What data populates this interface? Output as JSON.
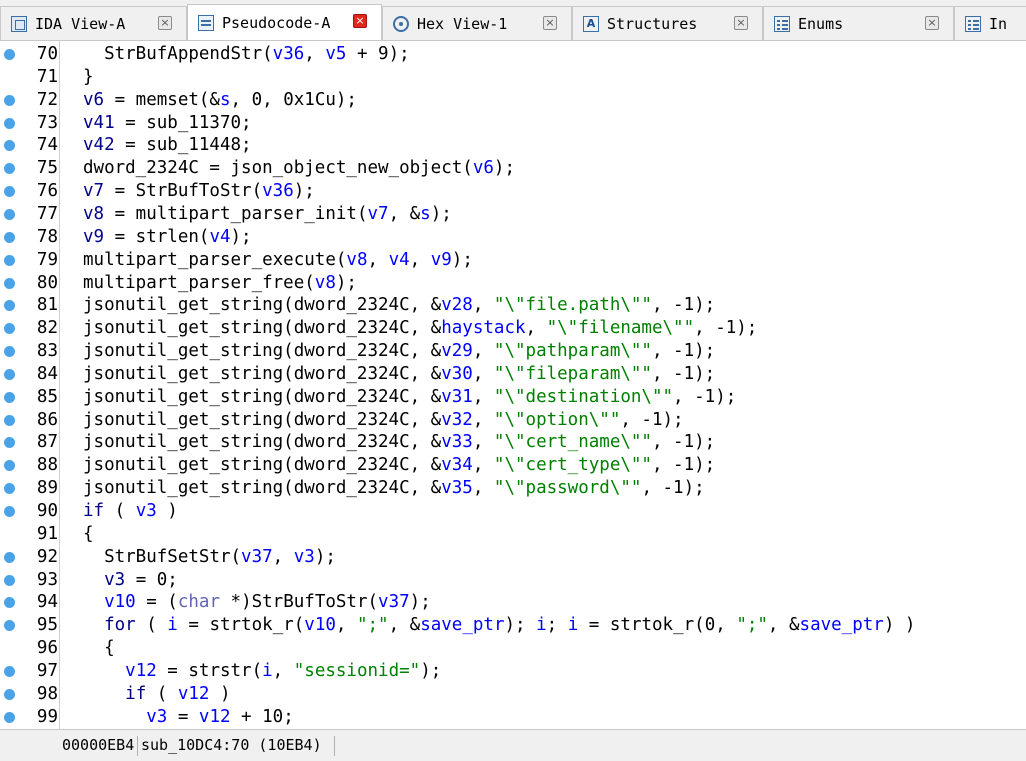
{
  "tabs": [
    {
      "label": "IDA View-A",
      "icon": "ida-view-icon",
      "active": false
    },
    {
      "label": "Pseudocode-A",
      "icon": "pseudocode-icon",
      "active": true
    },
    {
      "label": "Hex View-1",
      "icon": "hex-view-icon",
      "active": false
    },
    {
      "label": "Structures",
      "icon": "structures-icon",
      "active": false
    },
    {
      "label": "Enums",
      "icon": "enums-icon",
      "active": false
    },
    {
      "label": "In",
      "icon": "imports-icon",
      "active": false
    }
  ],
  "code": {
    "lines": [
      {
        "num": "70",
        "bp": true,
        "tokens": [
          [
            "  ",
            ""
          ],
          [
            "StrBufAppendStr",
            ""
          ],
          [
            "(",
            ""
          ],
          [
            "v36",
            "v"
          ],
          [
            ", ",
            ""
          ],
          [
            "v5",
            "v"
          ],
          [
            " + 9);",
            ""
          ]
        ]
      },
      {
        "num": "71",
        "bp": false,
        "tokens": [
          [
            "}",
            ""
          ]
        ]
      },
      {
        "num": "72",
        "bp": true,
        "tokens": [
          [
            "v6",
            "vv"
          ],
          [
            " = memset(&",
            ""
          ],
          [
            "s",
            "v"
          ],
          [
            ", 0, 0x1Cu);",
            ""
          ]
        ]
      },
      {
        "num": "73",
        "bp": true,
        "tokens": [
          [
            "v41",
            "vv"
          ],
          [
            " = sub_11370;",
            ""
          ]
        ]
      },
      {
        "num": "74",
        "bp": true,
        "tokens": [
          [
            "v42",
            "vv"
          ],
          [
            " = sub_11448;",
            ""
          ]
        ]
      },
      {
        "num": "75",
        "bp": true,
        "tokens": [
          [
            "dword_2324C = json_object_new_object(",
            ""
          ],
          [
            "v6",
            "v"
          ],
          [
            ");",
            ""
          ]
        ]
      },
      {
        "num": "76",
        "bp": true,
        "tokens": [
          [
            "v7",
            "vv"
          ],
          [
            " = StrBufToStr(",
            ""
          ],
          [
            "v36",
            "v"
          ],
          [
            ");",
            ""
          ]
        ]
      },
      {
        "num": "77",
        "bp": true,
        "tokens": [
          [
            "v8",
            "vv"
          ],
          [
            " = multipart_parser_init(",
            ""
          ],
          [
            "v7",
            "v"
          ],
          [
            ", &",
            ""
          ],
          [
            "s",
            "v"
          ],
          [
            ");",
            ""
          ]
        ]
      },
      {
        "num": "78",
        "bp": true,
        "tokens": [
          [
            "v9",
            "vv"
          ],
          [
            " = strlen(",
            ""
          ],
          [
            "v4",
            "v"
          ],
          [
            ");",
            ""
          ]
        ]
      },
      {
        "num": "79",
        "bp": true,
        "tokens": [
          [
            "multipart_parser_execute(",
            ""
          ],
          [
            "v8",
            "v"
          ],
          [
            ", ",
            ""
          ],
          [
            "v4",
            "v"
          ],
          [
            ", ",
            ""
          ],
          [
            "v9",
            "v"
          ],
          [
            ");",
            ""
          ]
        ]
      },
      {
        "num": "80",
        "bp": true,
        "tokens": [
          [
            "multipart_parser_free(",
            ""
          ],
          [
            "v8",
            "v"
          ],
          [
            ");",
            ""
          ]
        ]
      },
      {
        "num": "81",
        "bp": true,
        "tokens": [
          [
            "jsonutil_get_string(dword_2324C, &",
            ""
          ],
          [
            "v28",
            "v"
          ],
          [
            ", ",
            ""
          ],
          [
            "\"\\\"file.path\\\"\"",
            "str"
          ],
          [
            ", -1);",
            ""
          ]
        ]
      },
      {
        "num": "82",
        "bp": true,
        "tokens": [
          [
            "jsonutil_get_string(dword_2324C, &",
            ""
          ],
          [
            "haystack",
            "v"
          ],
          [
            ", ",
            ""
          ],
          [
            "\"\\\"filename\\\"\"",
            "str"
          ],
          [
            ", -1);",
            ""
          ]
        ]
      },
      {
        "num": "83",
        "bp": true,
        "tokens": [
          [
            "jsonutil_get_string(dword_2324C, &",
            ""
          ],
          [
            "v29",
            "v"
          ],
          [
            ", ",
            ""
          ],
          [
            "\"\\\"pathparam\\\"\"",
            "str"
          ],
          [
            ", -1);",
            ""
          ]
        ]
      },
      {
        "num": "84",
        "bp": true,
        "tokens": [
          [
            "jsonutil_get_string(dword_2324C, &",
            ""
          ],
          [
            "v30",
            "v"
          ],
          [
            ", ",
            ""
          ],
          [
            "\"\\\"fileparam\\\"\"",
            "str"
          ],
          [
            ", -1);",
            ""
          ]
        ]
      },
      {
        "num": "85",
        "bp": true,
        "tokens": [
          [
            "jsonutil_get_string(dword_2324C, &",
            ""
          ],
          [
            "v31",
            "v"
          ],
          [
            ", ",
            ""
          ],
          [
            "\"\\\"destination\\\"\"",
            "str"
          ],
          [
            ", -1);",
            ""
          ]
        ]
      },
      {
        "num": "86",
        "bp": true,
        "tokens": [
          [
            "jsonutil_get_string(dword_2324C, &",
            ""
          ],
          [
            "v32",
            "v"
          ],
          [
            ", ",
            ""
          ],
          [
            "\"\\\"option\\\"\"",
            "str"
          ],
          [
            ", -1);",
            ""
          ]
        ]
      },
      {
        "num": "87",
        "bp": true,
        "tokens": [
          [
            "jsonutil_get_string(dword_2324C, &",
            ""
          ],
          [
            "v33",
            "v"
          ],
          [
            ", ",
            ""
          ],
          [
            "\"\\\"cert_name\\\"\"",
            "str"
          ],
          [
            ", -1);",
            ""
          ]
        ]
      },
      {
        "num": "88",
        "bp": true,
        "tokens": [
          [
            "jsonutil_get_string(dword_2324C, &",
            ""
          ],
          [
            "v34",
            "v"
          ],
          [
            ", ",
            ""
          ],
          [
            "\"\\\"cert_type\\\"\"",
            "str"
          ],
          [
            ", -1);",
            ""
          ]
        ]
      },
      {
        "num": "89",
        "bp": true,
        "tokens": [
          [
            "jsonutil_get_string(dword_2324C, &",
            ""
          ],
          [
            "v35",
            "v"
          ],
          [
            ", ",
            ""
          ],
          [
            "\"\\\"password\\\"\"",
            "str"
          ],
          [
            ", -1);",
            ""
          ]
        ]
      },
      {
        "num": "90",
        "bp": true,
        "tokens": [
          [
            "if",
            "kw"
          ],
          [
            " ( ",
            ""
          ],
          [
            "v3",
            "v"
          ],
          [
            " )",
            ""
          ]
        ]
      },
      {
        "num": "91",
        "bp": false,
        "tokens": [
          [
            "{",
            ""
          ]
        ]
      },
      {
        "num": "92",
        "bp": true,
        "tokens": [
          [
            "  StrBufSetStr(",
            ""
          ],
          [
            "v37",
            "v"
          ],
          [
            ", ",
            ""
          ],
          [
            "v3",
            "v"
          ],
          [
            ");",
            ""
          ]
        ]
      },
      {
        "num": "93",
        "bp": true,
        "tokens": [
          [
            "  ",
            ""
          ],
          [
            "v3",
            "vv"
          ],
          [
            " = 0;",
            ""
          ]
        ]
      },
      {
        "num": "94",
        "bp": true,
        "tokens": [
          [
            "  ",
            ""
          ],
          [
            "v10",
            "v"
          ],
          [
            " = (",
            ""
          ],
          [
            "char",
            "dim"
          ],
          [
            " *)StrBufToStr(",
            ""
          ],
          [
            "v37",
            "v"
          ],
          [
            ");",
            ""
          ]
        ]
      },
      {
        "num": "95",
        "bp": true,
        "tokens": [
          [
            "  ",
            ""
          ],
          [
            "for",
            "kw"
          ],
          [
            " ( ",
            ""
          ],
          [
            "i",
            "v"
          ],
          [
            " = strtok_r(",
            ""
          ],
          [
            "v10",
            "v"
          ],
          [
            ", ",
            ""
          ],
          [
            "\";\"",
            "str"
          ],
          [
            ", &",
            ""
          ],
          [
            "save_ptr",
            "v"
          ],
          [
            "); ",
            ""
          ],
          [
            "i",
            "v"
          ],
          [
            "; ",
            ""
          ],
          [
            "i",
            "v"
          ],
          [
            " = strtok_r(0, ",
            ""
          ],
          [
            "\";\"",
            "str"
          ],
          [
            ", &",
            ""
          ],
          [
            "save_ptr",
            "v"
          ],
          [
            ") )",
            ""
          ]
        ]
      },
      {
        "num": "96",
        "bp": false,
        "tokens": [
          [
            "  {",
            ""
          ]
        ]
      },
      {
        "num": "97",
        "bp": true,
        "tokens": [
          [
            "    ",
            ""
          ],
          [
            "v12",
            "v"
          ],
          [
            " = strstr(",
            ""
          ],
          [
            "i",
            "v"
          ],
          [
            ", ",
            ""
          ],
          [
            "\"sessionid=\"",
            "str"
          ],
          [
            ");",
            ""
          ]
        ]
      },
      {
        "num": "98",
        "bp": true,
        "tokens": [
          [
            "    ",
            ""
          ],
          [
            "if",
            "kw"
          ],
          [
            " ( ",
            ""
          ],
          [
            "v12",
            "v"
          ],
          [
            " )",
            ""
          ]
        ]
      },
      {
        "num": "99",
        "bp": true,
        "tokens": [
          [
            "      ",
            ""
          ],
          [
            "v3",
            "v"
          ],
          [
            " = ",
            ""
          ],
          [
            "v12",
            "v"
          ],
          [
            " + 10;",
            ""
          ]
        ]
      }
    ]
  },
  "status": {
    "address": "00000EB4",
    "location": "sub_10DC4:70 (10EB4)"
  }
}
